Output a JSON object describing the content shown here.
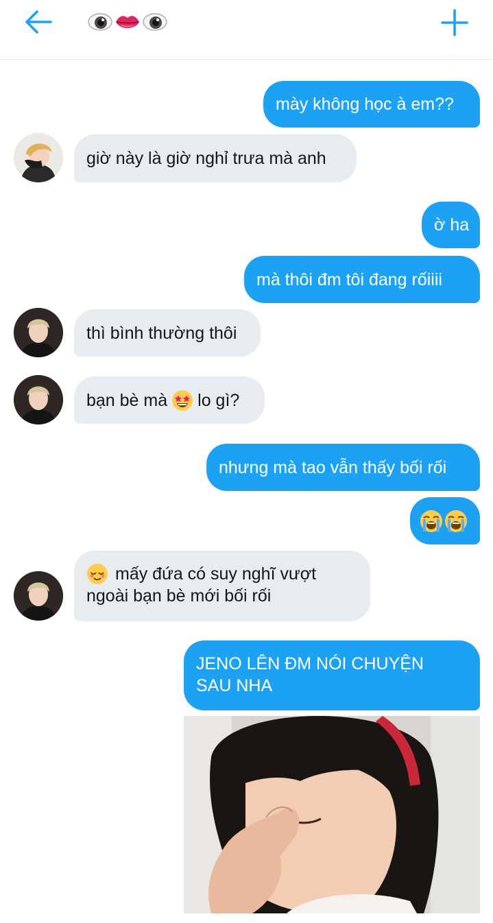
{
  "header": {
    "back_icon": "arrow-left-icon",
    "title_icons": [
      "eye-emoji-icon",
      "lips-emoji-icon",
      "eye-emoji-icon"
    ],
    "new_message_icon": "plus-icon",
    "accent_color": "#1da1f2"
  },
  "messages": [
    {
      "id": "m1",
      "direction": "outgoing",
      "text": "mày không học à em??"
    },
    {
      "id": "m2",
      "direction": "incoming",
      "text": "giờ này là giờ nghỉ trưa mà anh"
    },
    {
      "id": "m3",
      "direction": "outgoing",
      "text": "ờ ha"
    },
    {
      "id": "m4",
      "direction": "outgoing",
      "text": "mà thôi đm tôi đang rốiiii"
    },
    {
      "id": "m5",
      "direction": "incoming",
      "text": "thì bình thường thôi"
    },
    {
      "id": "m6",
      "direction": "incoming",
      "text_before": "bạn bè mà",
      "emoji": "star-struck-emoji-icon",
      "text_after": "lo gì?"
    },
    {
      "id": "m7",
      "direction": "outgoing",
      "text": "nhưng mà tao vẫn thấy bối rối"
    },
    {
      "id": "m8",
      "direction": "outgoing",
      "emoji": [
        "loudly-crying-emoji-icon",
        "loudly-crying-emoji-icon"
      ]
    },
    {
      "id": "m9",
      "direction": "incoming",
      "emoji": "relieved-emoji-icon",
      "line1": "mấy đứa có suy nghĩ vượt",
      "line2": "ngoài bạn bè mới bối rối"
    },
    {
      "id": "m10",
      "direction": "outgoing",
      "line1": "JENO LÊN ĐM NÓI CHUYỆN",
      "line2": "SAU NHA"
    },
    {
      "id": "m11",
      "direction": "outgoing",
      "media": "crying-child-photo"
    }
  ],
  "colors": {
    "outgoing_bubble": "#1da1f2",
    "incoming_bubble": "#e6ecf0",
    "outgoing_text": "#ffffff",
    "incoming_text": "#14171a"
  }
}
